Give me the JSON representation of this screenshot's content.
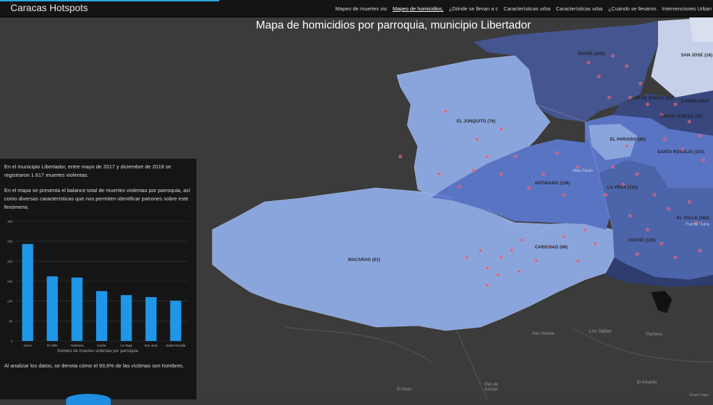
{
  "app": {
    "title": "Caracas Hotspots"
  },
  "nav": {
    "tabs": [
      {
        "label": "Mapeo de muertes vio"
      },
      {
        "label": "Mapeo de homicidios,"
      },
      {
        "label": "¿Dónde se llevan a c"
      },
      {
        "label": "Características urba"
      },
      {
        "label": "Características urba"
      },
      {
        "label": "¿Cuándo se llevaron"
      },
      {
        "label": "Intervenciones Urban"
      }
    ],
    "active_index": 1
  },
  "map": {
    "title": "Mapa de homicidios por parroquia, municipio Libertador",
    "parish_labels": [
      "SUCRE (243)",
      "SAN JOSE (18)",
      "23 DE ENERO (61)",
      "CANDELARIA",
      "SANTA TERESA (21)",
      "EL JUNQUITO (76)",
      "EL PARAISO (80)",
      "SANTA ROSALIA (101)",
      "ANTIMANO (159)",
      "LA VEGA (115)",
      "EL VALLE (162)",
      "CARICUAO (69)",
      "MACARAO (61)",
      "COCHE (125)"
    ],
    "place_labels": [
      "Altar Paulo",
      "Fuerte Tiuna",
      "San Vicente",
      "Los Salias",
      "Pacheco",
      "El Paso",
      "Pan de Azúcar",
      "El Amarillo",
      "Grupo Ingo"
    ]
  },
  "panel": {
    "paragraph1": "En el municipio Libertador, entre mayo de 2017 y diciembre de 2018 se registraron 1.617 muertes violentas.",
    "paragraph2": "En el mapa se presenta el balance total de muertes violentas por parroquia, así como diversas características que nos permiten identificar patrones sobre este fenómeno.",
    "paragraph3": "Al analizar los datos, se denota cómo el 93,6% de las víctimas son hombres."
  },
  "chart_data": {
    "type": "bar",
    "categories": [
      "Sucre",
      "El Valle",
      "Antimano",
      "Coche",
      "La Vega",
      "San Juan",
      "Santa Rosalia"
    ],
    "values": [
      243,
      162,
      159,
      125,
      115,
      110,
      101
    ],
    "xlabel": "Número de muertes violentas por parroquia.",
    "ylabel": "",
    "ylim": [
      0,
      300
    ],
    "yticks": [
      0,
      50,
      100,
      150,
      200,
      250,
      300
    ],
    "grid": true,
    "bar_color": "#1f96e6"
  },
  "colors": {
    "accent": "#2aa9e0",
    "light_parish": "#8aa4dc",
    "mid_parish": "#5a74c4",
    "dark_parish": "#44558f",
    "dot": "#e0546a"
  }
}
